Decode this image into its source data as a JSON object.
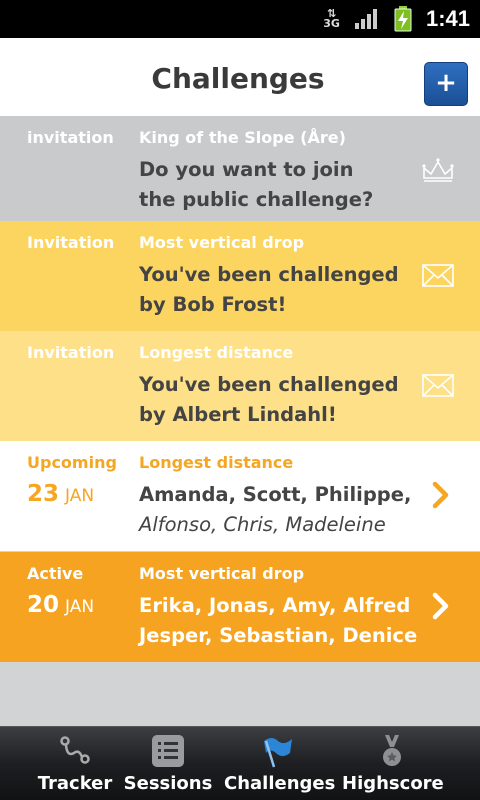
{
  "status_bar": {
    "network": "3G",
    "time": "1:41"
  },
  "header": {
    "title": "Challenges",
    "add_button": "+"
  },
  "challenges": [
    {
      "status": "invitation",
      "type": "King of the Slope (Åre)",
      "line1": "Do you want to join",
      "line2": "the public challenge?",
      "icon": "crown-icon",
      "colors": {
        "bg": "#c9cacc",
        "status": "#ffffff",
        "type": "#ffffff",
        "text": "#444444"
      }
    },
    {
      "status": "Invitation",
      "type": "Most vertical drop",
      "line1": "You've been challenged",
      "line2": "by Bob Frost!",
      "icon": "envelope-icon",
      "colors": {
        "bg": "#fcd561",
        "status": "#ffffff",
        "type": "#ffffff",
        "text": "#444444"
      }
    },
    {
      "status": "Invitation",
      "type": "Longest distance",
      "line1": "You've been challenged",
      "line2": "by Albert Lindahl!",
      "icon": "envelope-icon",
      "colors": {
        "bg": "#fde088",
        "status": "#ffffff",
        "type": "#ffffff",
        "text": "#444444"
      }
    },
    {
      "status": "Upcoming",
      "date_day": "23",
      "date_month": "JAN",
      "type": "Longest distance",
      "line1": "Amanda, Scott, Philippe,",
      "line2": "Alfonso, Chris, Madeleine",
      "icon": "chevron-right-icon",
      "colors": {
        "bg": "#ffffff",
        "status": "#f5a623",
        "type": "#f5a623",
        "text": "#444444"
      }
    },
    {
      "status": "Active",
      "date_day": "20",
      "date_month": "JAN",
      "type": "Most vertical drop",
      "line1": "Erika, Jonas, Amy, Alfred",
      "line2": "Jesper, Sebastian, Denice",
      "icon": "chevron-right-icon",
      "colors": {
        "bg": "#f5a321",
        "status": "#ffffff",
        "type": "#ffffff",
        "text": "#ffffff"
      }
    }
  ],
  "tabs": [
    {
      "label": "Tracker",
      "icon": "route-icon",
      "active": false
    },
    {
      "label": "Sessions",
      "icon": "list-icon",
      "active": false
    },
    {
      "label": "Challenges",
      "icon": "flag-icon",
      "active": true
    },
    {
      "label": "Highscore",
      "icon": "medal-icon",
      "active": false
    }
  ]
}
